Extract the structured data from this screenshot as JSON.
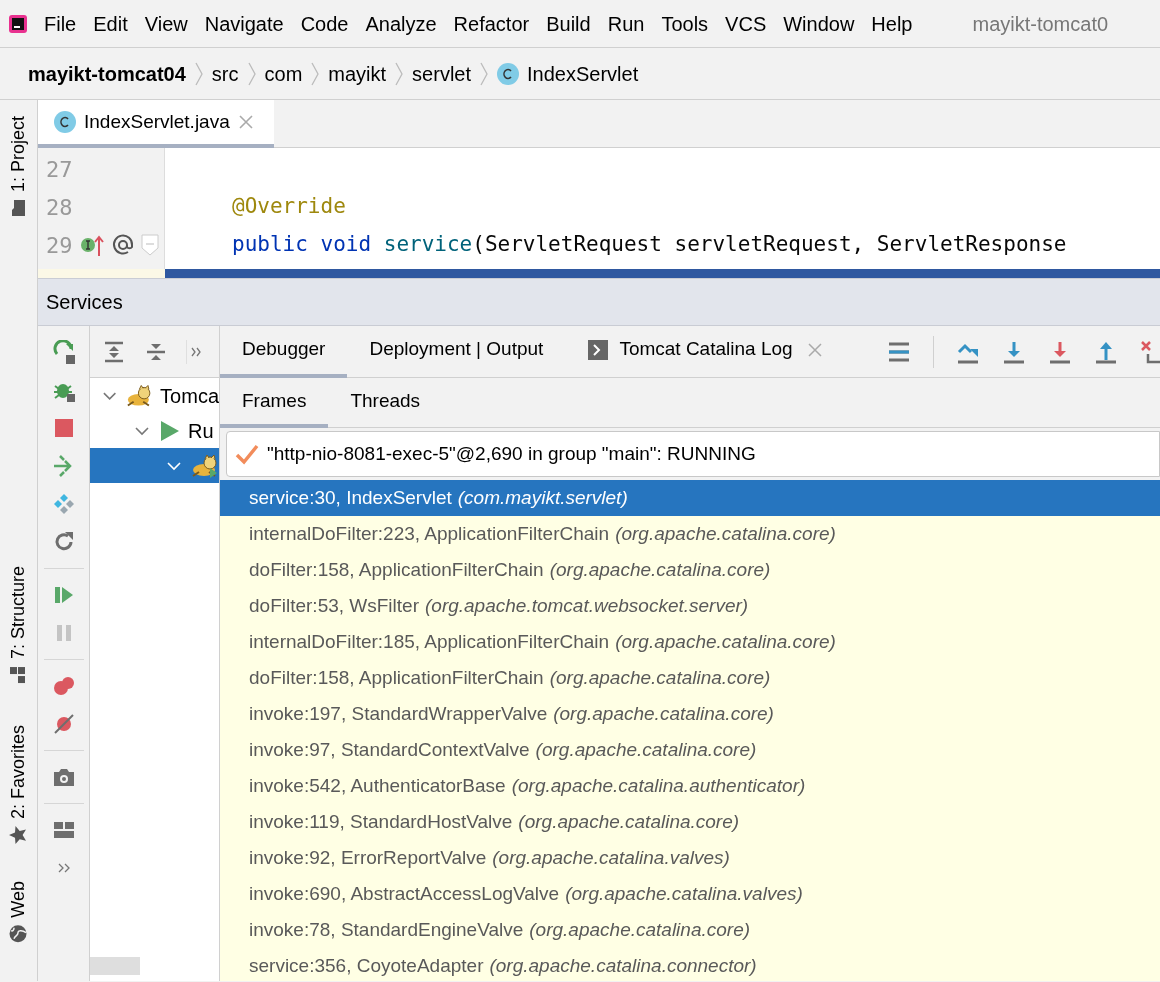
{
  "menu": {
    "items": [
      "File",
      "Edit",
      "View",
      "Navigate",
      "Code",
      "Analyze",
      "Refactor",
      "Build",
      "Run",
      "Tools",
      "VCS",
      "Window",
      "Help"
    ],
    "project_title": "mayikt-tomcat0"
  },
  "breadcrumbs": [
    {
      "label": "mayikt-tomcat04",
      "kind": "project"
    },
    {
      "label": "src",
      "kind": "folder"
    },
    {
      "label": "com",
      "kind": "folder"
    },
    {
      "label": "mayikt",
      "kind": "folder"
    },
    {
      "label": "servlet",
      "kind": "folder"
    },
    {
      "label": "IndexServlet",
      "kind": "class"
    }
  ],
  "tool_stripe": [
    {
      "label": "1: Project",
      "kind": "folder"
    },
    {
      "label": "7: Structure",
      "kind": "structure"
    },
    {
      "label": "2: Favorites",
      "kind": "star"
    },
    {
      "label": "Web",
      "kind": "globe"
    }
  ],
  "editor": {
    "tabs": [
      {
        "label": "IndexServlet.java",
        "selected": true
      }
    ],
    "lines": [
      {
        "number": "27",
        "kind": "code"
      },
      {
        "number": "28",
        "kind": "code",
        "tokens": [
          {
            "text": "@Override",
            "kind": "annotation"
          }
        ]
      },
      {
        "number": "29",
        "kind": "code",
        "tokens": [
          {
            "text": "public ",
            "kind": "keyword"
          },
          {
            "text": "void ",
            "kind": "keyword"
          },
          {
            "text": "service",
            "kind": "method"
          },
          {
            "text": "(ServletRequest servletRequest, ServletResponse",
            "kind": "plain"
          }
        ]
      },
      {
        "kind": "execution-point"
      }
    ]
  },
  "services": {
    "title": "Services",
    "tree": [
      {
        "label": "Tomca",
        "kind": "tomcat",
        "expanded": true,
        "selected": false,
        "children": [
          {
            "label": "Ru",
            "kind": "run",
            "expanded": true,
            "selected": false,
            "children": [
              {
                "kind": "tomcat-debug",
                "expanded": true,
                "selected": true
              }
            ]
          }
        ]
      }
    ],
    "tabs": [
      {
        "label": "Debugger",
        "kind": "plain",
        "selected": true,
        "closable": false
      },
      {
        "label": "Deployment | Output",
        "kind": "plain",
        "selected": false,
        "closable": false
      },
      {
        "label": "Tomcat Catalina Log",
        "kind": "console",
        "selected": false,
        "closable": true
      }
    ],
    "sub_tabs": [
      {
        "label": "Frames",
        "selected": true
      },
      {
        "label": "Threads",
        "selected": false
      }
    ],
    "thread": {
      "value": "\"http-nio-8081-exec-5\"@2,690 in group \"main\": RUNNING"
    },
    "frames": [
      {
        "method": "service:30, IndexServlet",
        "package": "(com.mayikt.servlet)",
        "selected": true
      },
      {
        "method": "internalDoFilter:223, ApplicationFilterChain",
        "package": "(org.apache.catalina.core)",
        "selected": false
      },
      {
        "method": "doFilter:158, ApplicationFilterChain",
        "package": "(org.apache.catalina.core)",
        "selected": false
      },
      {
        "method": "doFilter:53, WsFilter",
        "package": "(org.apache.tomcat.websocket.server)",
        "selected": false
      },
      {
        "method": "internalDoFilter:185, ApplicationFilterChain",
        "package": "(org.apache.catalina.core)",
        "selected": false
      },
      {
        "method": "doFilter:158, ApplicationFilterChain",
        "package": "(org.apache.catalina.core)",
        "selected": false
      },
      {
        "method": "invoke:197, StandardWrapperValve",
        "package": "(org.apache.catalina.core)",
        "selected": false
      },
      {
        "method": "invoke:97, StandardContextValve",
        "package": "(org.apache.catalina.core)",
        "selected": false
      },
      {
        "method": "invoke:542, AuthenticatorBase",
        "package": "(org.apache.catalina.authenticator)",
        "selected": false
      },
      {
        "method": "invoke:119, StandardHostValve",
        "package": "(org.apache.catalina.core)",
        "selected": false
      },
      {
        "method": "invoke:92, ErrorReportValve",
        "package": "(org.apache.catalina.valves)",
        "selected": false
      },
      {
        "method": "invoke:690, AbstractAccessLogValve",
        "package": "(org.apache.catalina.valves)",
        "selected": false
      },
      {
        "method": "invoke:78, StandardEngineValve",
        "package": "(org.apache.catalina.core)",
        "selected": false
      },
      {
        "method": "service:356, CoyoteAdapter",
        "package": "(org.apache.catalina.connector)",
        "selected": false
      }
    ]
  }
}
